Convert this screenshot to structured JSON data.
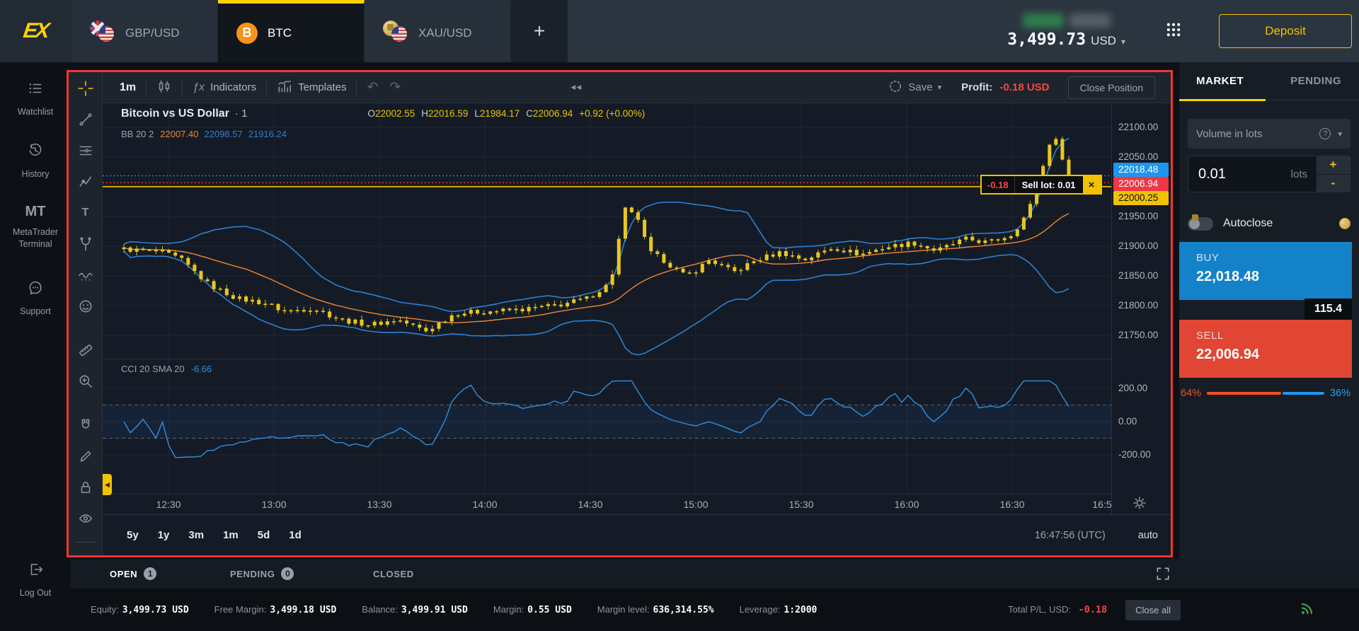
{
  "topbar": {
    "logo_text": "EX",
    "tabs": [
      {
        "label": "GBP/USD",
        "icon": "gbpusd-flags",
        "active": false
      },
      {
        "label": "BTC",
        "icon": "btc-coin",
        "active": true
      },
      {
        "label": "XAU/USD",
        "icon": "xauusd-flags",
        "active": false
      }
    ],
    "add_tab": "+",
    "balance": "3,499.73",
    "currency": "USD",
    "deposit": "Deposit"
  },
  "sidebar": {
    "items": [
      {
        "icon": "watchlist-icon",
        "label": "Watchlist"
      },
      {
        "icon": "history-icon",
        "label": "History"
      },
      {
        "icon": "mt-icon",
        "label": "MetaTrader Terminal"
      },
      {
        "icon": "support-icon",
        "label": "Support"
      }
    ],
    "logout": {
      "icon": "logout-icon",
      "label": "Log Out"
    }
  },
  "chart": {
    "toolbar": {
      "timeframe": "1m",
      "indicators": "Indicators",
      "templates": "Templates",
      "save": "Save",
      "profit_label": "Profit:",
      "profit_value": "-0.18 USD",
      "close_position": "Close Position"
    },
    "draw_tools": [
      "crosshair-icon",
      "trendline-icon",
      "horizontal-lines-icon",
      "polyline-icon",
      "text-tool-icon",
      "pitchfork-icon",
      "wave-icon",
      "emoji-icon",
      "ruler-icon",
      "zoom-in-icon",
      "magnet-icon",
      "draw-edit-icon",
      "lock-icon",
      "hide-drawings-icon"
    ],
    "title": "Bitcoin vs US Dollar",
    "resolution": "· 1",
    "ranges": [
      "5y",
      "1y",
      "3m",
      "1m",
      "5d",
      "1d"
    ],
    "clock": "16:47:56 (UTC)",
    "scale_mode": "auto",
    "tooltip": {
      "pl": "-0.18",
      "label": "Sell lot: 0.01",
      "close": "×"
    }
  },
  "chart_data": {
    "type": "candlestick",
    "title": "Bitcoin vs US Dollar",
    "interval": "1m",
    "ohlc": {
      "open": 22002.55,
      "high": 22016.59,
      "low": 21984.17,
      "close": 22006.94,
      "change_text": "+0.92 (+0.00%)"
    },
    "indicators": [
      {
        "name": "BB",
        "params": "20 2",
        "basis": 22007.4,
        "upper": 22098.57,
        "lower": 21916.24
      },
      {
        "name": "CCI",
        "params": "20 SMA 20",
        "value": -6.66
      }
    ],
    "y_axis": {
      "ticks": [
        22100,
        22050,
        21950,
        21900,
        21850,
        21800,
        21750
      ],
      "grid_extra": [
        22000
      ],
      "visible_range": [
        21730,
        22120
      ]
    },
    "cci_axis": {
      "ticks": [
        200,
        0,
        -200
      ],
      "band": [
        100,
        -100
      ]
    },
    "x_axis": {
      "ticks": [
        "12:30",
        "13:00",
        "13:30",
        "14:00",
        "14:30",
        "15:00",
        "15:30",
        "16:00",
        "16:30",
        "16:5"
      ]
    },
    "price_lines": {
      "buy": 22018.48,
      "sell": 22006.94,
      "order": 22000.25
    },
    "open_position": {
      "side": "sell",
      "lot": 0.01,
      "pl_usd": -0.18,
      "entry": 22000.25
    },
    "price_anchors": [
      [
        0,
        21895
      ],
      [
        0.04,
        21890
      ],
      [
        0.06,
        21878
      ],
      [
        0.09,
        21835
      ],
      [
        0.12,
        21812
      ],
      [
        0.15,
        21804
      ],
      [
        0.17,
        21790
      ],
      [
        0.2,
        21796
      ],
      [
        0.23,
        21776
      ],
      [
        0.26,
        21768
      ],
      [
        0.29,
        21776
      ],
      [
        0.32,
        21757
      ],
      [
        0.35,
        21787
      ],
      [
        0.38,
        21790
      ],
      [
        0.42,
        21793
      ],
      [
        0.46,
        21801
      ],
      [
        0.49,
        21812
      ],
      [
        0.515,
        21838
      ],
      [
        0.53,
        21962
      ],
      [
        0.545,
        21945
      ],
      [
        0.555,
        21890
      ],
      [
        0.57,
        21878
      ],
      [
        0.595,
        21848
      ],
      [
        0.62,
        21877
      ],
      [
        0.645,
        21856
      ],
      [
        0.67,
        21877
      ],
      [
        0.695,
        21890
      ],
      [
        0.72,
        21877
      ],
      [
        0.75,
        21898
      ],
      [
        0.78,
        21886
      ],
      [
        0.805,
        21898
      ],
      [
        0.835,
        21906
      ],
      [
        0.86,
        21892
      ],
      [
        0.89,
        21912
      ],
      [
        0.915,
        21906
      ],
      [
        0.94,
        21920
      ],
      [
        0.957,
        21958
      ],
      [
        0.972,
        22030
      ],
      [
        0.982,
        22088
      ],
      [
        0.99,
        22068
      ],
      [
        1,
        22012
      ]
    ]
  },
  "order_panel": {
    "tabs": [
      "MARKET",
      "PENDING"
    ],
    "volume_label": "Volume in lots",
    "lots_value": "0.01",
    "lots_unit": "lots",
    "plus": "+",
    "minus": "-",
    "autoclose_label": "Autoclose",
    "autoclose_enabled": false,
    "buy_label": "BUY",
    "buy_price": "22,018.48",
    "sell_label": "SELL",
    "sell_price": "22,006.94",
    "spread": "115.4",
    "sentiment": {
      "buy_pct": "64%",
      "sell_pct": "36%",
      "buy_ratio": 0.64
    }
  },
  "positions": {
    "tabs": [
      {
        "label": "OPEN",
        "badge": "1",
        "active": true
      },
      {
        "label": "PENDING",
        "badge": "0",
        "active": false
      },
      {
        "label": "CLOSED",
        "badge": "",
        "active": false
      }
    ]
  },
  "footer": {
    "stats": [
      {
        "label": "Equity:",
        "value": "3,499.73 USD"
      },
      {
        "label": "Free Margin:",
        "value": "3,499.18 USD"
      },
      {
        "label": "Balance:",
        "value": "3,499.91 USD"
      },
      {
        "label": "Margin:",
        "value": "0.55 USD"
      },
      {
        "label": "Margin level:",
        "value": "636,314.55%"
      },
      {
        "label": "Leverage:",
        "value": "1:2000"
      }
    ],
    "total_pl_label": "Total P/L, USD:",
    "total_pl_value": "-0.18",
    "close_all": "Close all"
  }
}
